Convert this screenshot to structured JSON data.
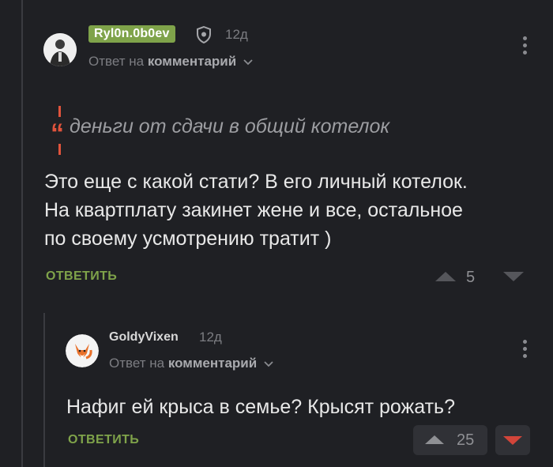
{
  "comment": {
    "author": "Ryl0n.0b0ev",
    "time": "12д",
    "reply_prefix": "Ответ на",
    "reply_target": "комментарий",
    "quote": "деньги от сдачи в общий котелок",
    "body_lines": [
      "Это еще с какой стати? В его личный котелок.",
      "На квартплату закинет жене и все, остальное",
      "по своему усмотрению тратит )"
    ],
    "reply_label": "ОТВЕТИТЬ",
    "rating": "5"
  },
  "reply": {
    "author": "GoldyVixen",
    "time": "12д",
    "reply_prefix": "Ответ на",
    "reply_target": "комментарий",
    "body": "Нафиг ей крыса в семье? Крысят рожать?",
    "reply_label": "ОТВЕТИТЬ",
    "rating": "25"
  },
  "icons": {
    "shield": "shield-icon",
    "more": "more-vertical-icon",
    "chevron": "chevron-down-icon",
    "upvote": "upvote-icon",
    "downvote": "downvote-icon"
  },
  "colors": {
    "background": "#1f2024",
    "accent_green": "#7fa34a",
    "downvote_active": "#d2453a",
    "quote_accent": "#e0533c"
  }
}
